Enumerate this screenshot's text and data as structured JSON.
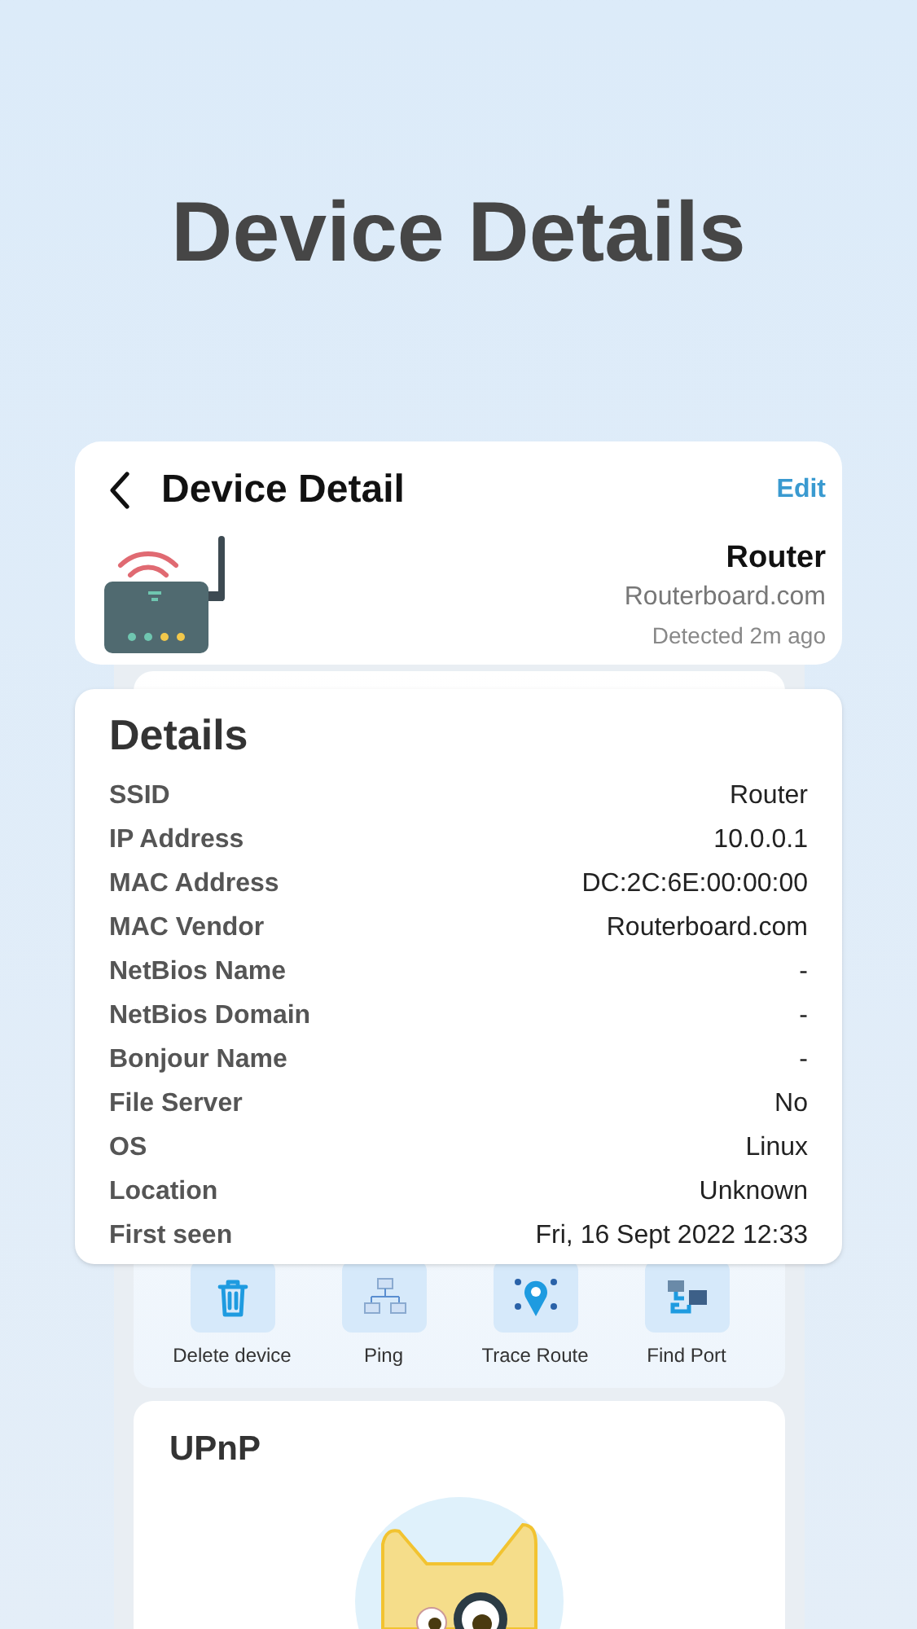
{
  "headline": "Device Details",
  "header": {
    "title": "Device Detail",
    "action": "Edit",
    "device": {
      "name": "Router",
      "vendor": "Routerboard.com",
      "detected": "Detected 2m ago"
    }
  },
  "details": {
    "title": "Details",
    "rows": [
      {
        "label": "SSID",
        "value": "Router"
      },
      {
        "label": "IP Address",
        "value": "10.0.0.1"
      },
      {
        "label": "MAC Address",
        "value": "DC:2C:6E:00:00:00"
      },
      {
        "label": "MAC Vendor",
        "value": "Routerboard.com"
      },
      {
        "label": "NetBios Name",
        "value": "-"
      },
      {
        "label": "NetBios Domain",
        "value": "-"
      },
      {
        "label": "Bonjour Name",
        "value": "-"
      },
      {
        "label": "File Server",
        "value": "No"
      },
      {
        "label": "OS",
        "value": "Linux"
      },
      {
        "label": "Location",
        "value": "Unknown"
      },
      {
        "label": "First seen",
        "value": "Fri, 16 Sept 2022 12:33"
      }
    ]
  },
  "actions": [
    {
      "kind": "delete",
      "label": "Delete device"
    },
    {
      "kind": "ping",
      "label": "Ping"
    },
    {
      "kind": "trace",
      "label": "Trace Route"
    },
    {
      "kind": "port",
      "label": "Find Port"
    }
  ],
  "upnp": {
    "title": "UPnP"
  }
}
